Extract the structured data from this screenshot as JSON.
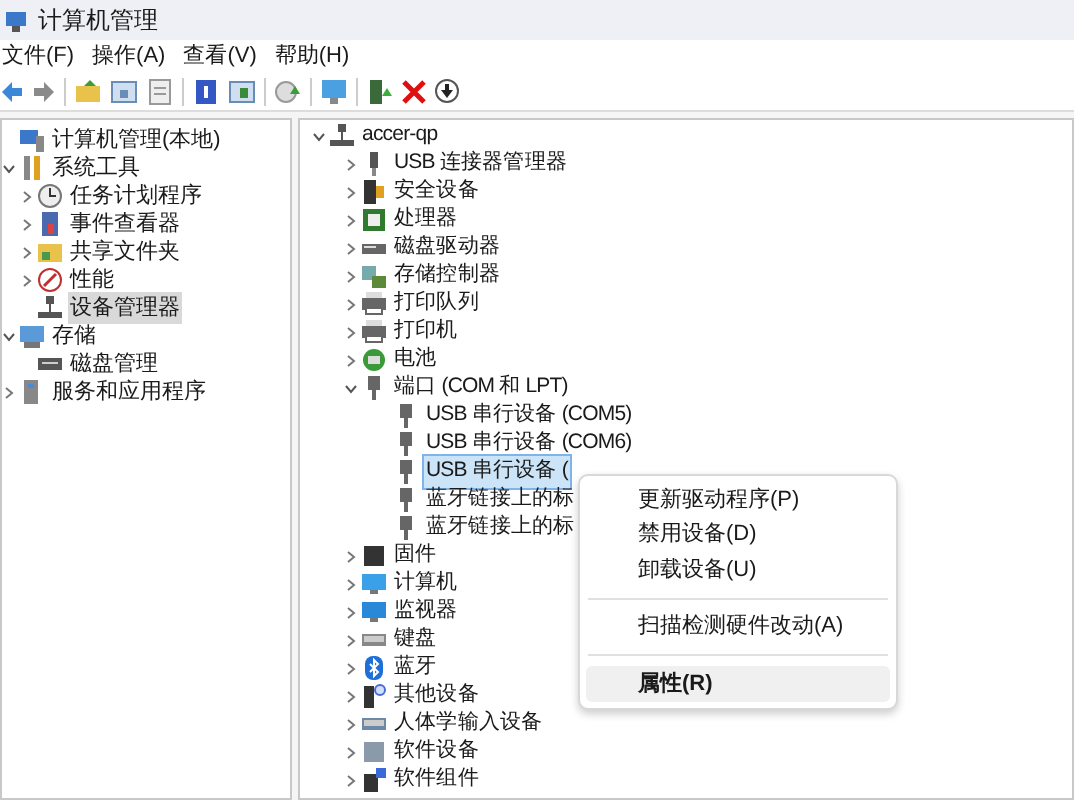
{
  "window": {
    "title": "计算机管理"
  },
  "menu_bar": [
    "文件(F)",
    "操作(A)",
    "查看(V)",
    "帮助(H)"
  ],
  "left_tree": [
    {
      "label": "计算机管理(本地)",
      "selected": false,
      "children": [
        {
          "label": "系统工具",
          "expanded": true,
          "selected": false,
          "children": [
            {
              "label": "任务计划程序",
              "expanded": false,
              "selected": false
            },
            {
              "label": "事件查看器",
              "expanded": false,
              "selected": false
            },
            {
              "label": "共享文件夹",
              "expanded": false,
              "selected": false
            },
            {
              "label": "性能",
              "expanded": false,
              "selected": false
            },
            {
              "label": "设备管理器",
              "selected": true
            }
          ]
        },
        {
          "label": "存储",
          "expanded": true,
          "selected": false,
          "children": [
            {
              "label": "磁盘管理",
              "selected": false
            }
          ]
        },
        {
          "label": "服务和应用程序",
          "expanded": false,
          "selected": false
        }
      ]
    }
  ],
  "device_tree": [
    {
      "label": "accer-qp",
      "expanded": true,
      "selected": false,
      "children": [
        {
          "label": "USB 连接器管理器",
          "expanded": false,
          "selected": false
        },
        {
          "label": "安全设备",
          "expanded": false,
          "selected": false
        },
        {
          "label": "处理器",
          "expanded": false,
          "selected": false
        },
        {
          "label": "磁盘驱动器",
          "expanded": false,
          "selected": false
        },
        {
          "label": "存储控制器",
          "expanded": false,
          "selected": false
        },
        {
          "label": "打印队列",
          "expanded": false,
          "selected": false
        },
        {
          "label": "打印机",
          "expanded": false,
          "selected": false
        },
        {
          "label": "电池",
          "expanded": false,
          "selected": false
        },
        {
          "label": "端口 (COM 和 LPT)",
          "expanded": true,
          "selected": false,
          "children": [
            {
              "label": "USB 串行设备 (COM5)",
              "selected": false
            },
            {
              "label": "USB 串行设备 (COM6)",
              "selected": false
            },
            {
              "label": "USB 串行设备 (",
              "selected": true
            },
            {
              "label": "蓝牙链接上的标",
              "selected": false
            },
            {
              "label": "蓝牙链接上的标",
              "selected": false
            }
          ]
        },
        {
          "label": "固件",
          "expanded": false,
          "selected": false
        },
        {
          "label": "计算机",
          "expanded": false,
          "selected": false
        },
        {
          "label": "监视器",
          "expanded": false,
          "selected": false
        },
        {
          "label": "键盘",
          "expanded": false,
          "selected": false
        },
        {
          "label": "蓝牙",
          "expanded": false,
          "selected": false
        },
        {
          "label": "其他设备",
          "expanded": false,
          "selected": false
        },
        {
          "label": "人体学输入设备",
          "expanded": false,
          "selected": false
        },
        {
          "label": "软件设备",
          "expanded": false,
          "selected": false
        },
        {
          "label": "软件组件",
          "expanded": false,
          "selected": false
        }
      ]
    }
  ],
  "context_menu": [
    {
      "kind": "item",
      "label": "更新驱动程序(P)",
      "selected": false,
      "default": false
    },
    {
      "kind": "item",
      "label": "禁用设备(D)",
      "selected": false,
      "default": false
    },
    {
      "kind": "item",
      "label": "卸载设备(U)",
      "selected": false,
      "default": false
    },
    {
      "kind": "separator"
    },
    {
      "kind": "item",
      "label": "扫描检测硬件改动(A)",
      "selected": false,
      "default": false
    },
    {
      "kind": "separator"
    },
    {
      "kind": "item",
      "label": "属性(R)",
      "selected": true,
      "default": true
    }
  ]
}
